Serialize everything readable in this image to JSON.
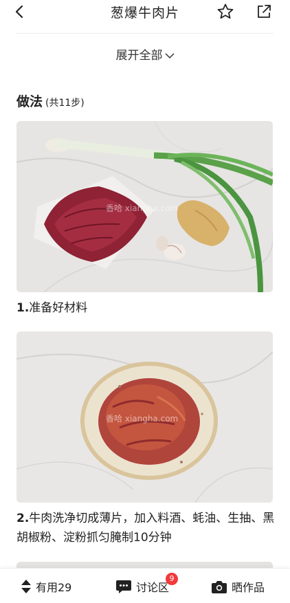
{
  "header": {
    "title": "葱爆牛肉片",
    "back_icon": "chevron-left-icon",
    "star_icon": "star-outline-icon",
    "share_icon": "share-external-icon"
  },
  "expand_all": {
    "label": "展开全部",
    "icon": "chevron-down-icon"
  },
  "method": {
    "title": "做法",
    "count": "(共11步)"
  },
  "steps": [
    {
      "number": "1.",
      "text": "准备好材料",
      "watermark": "香哈 xiangha.com"
    },
    {
      "number": "2.",
      "text": "牛肉洗净切成薄片，加入料酒、蚝油、生抽、黑胡椒粉、淀粉抓匀腌制10分钟",
      "watermark": "香哈 xiangha.com"
    }
  ],
  "bottom_bar": {
    "useful": {
      "label": "有用29",
      "icon": "up-down-arrows-icon"
    },
    "discuss": {
      "label": "讨论区",
      "badge": "9",
      "icon": "comment-icon"
    },
    "show": {
      "label": "晒作品",
      "icon": "camera-icon"
    }
  },
  "colors": {
    "badge": "#f23a3a",
    "text": "#222222"
  }
}
